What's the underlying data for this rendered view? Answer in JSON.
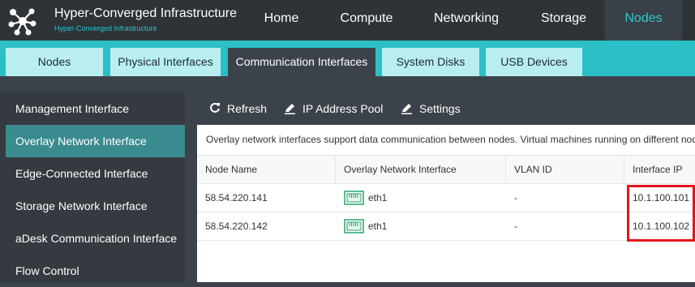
{
  "app": {
    "title": "Hyper-Converged Infrastructure",
    "subtitle": "Hyper-Converged Infrastructure"
  },
  "nav": {
    "items": [
      {
        "label": "Home"
      },
      {
        "label": "Compute"
      },
      {
        "label": "Networking"
      },
      {
        "label": "Storage"
      },
      {
        "label": "Nodes",
        "active": true
      }
    ]
  },
  "subtabs": [
    {
      "label": "Nodes"
    },
    {
      "label": "Physical Interfaces"
    },
    {
      "label": "Communication Interfaces",
      "active": true
    },
    {
      "label": "System Disks"
    },
    {
      "label": "USB Devices"
    }
  ],
  "sidebar": {
    "items": [
      {
        "label": "Management Interface"
      },
      {
        "label": "Overlay Network Interface",
        "active": true
      },
      {
        "label": "Edge-Connected Interface"
      },
      {
        "label": "Storage Network Interface"
      },
      {
        "label": "aDesk Communication Interface"
      },
      {
        "label": "Flow Control"
      }
    ]
  },
  "toolbar": {
    "refresh_label": "Refresh",
    "ip_pool_label": "IP Address Pool",
    "settings_label": "Settings"
  },
  "description": "Overlay network interfaces support data communication between nodes. Virtual machines running on different nodes",
  "table": {
    "columns": [
      "Node Name",
      "Overlay Network Interface",
      "VLAN ID",
      "Interface IP"
    ],
    "rows": [
      {
        "node": "58.54.220.141",
        "iface": "eth1",
        "vlan": "-",
        "ip": "10.1.100.101"
      },
      {
        "node": "58.54.220.142",
        "iface": "eth1",
        "vlan": "-",
        "ip": "10.1.100.102"
      }
    ]
  },
  "colors": {
    "accent": "#2cbfc7",
    "topbar": "#2e3338",
    "highlight": "#e3161b",
    "nic_icon": "#2aa56a"
  },
  "icons": {
    "logo": "molecule-logo-icon",
    "refresh": "refresh-icon",
    "ip_pool": "pencil-icon",
    "settings": "pencil-icon",
    "nic": "network-port-icon"
  }
}
